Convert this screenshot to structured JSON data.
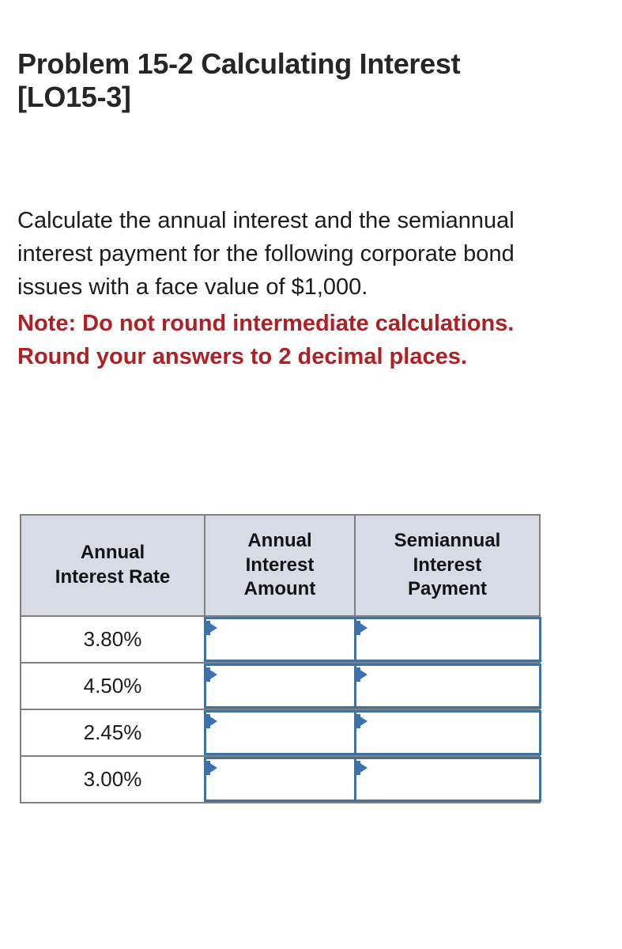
{
  "problem": {
    "title": "Problem 15-2 Calculating Interest [LO15-3]",
    "prompt": "Calculate the annual interest and the semiannual interest payment for the following corporate bond issues with a face value of $1,000.",
    "note": "Note: Do not round intermediate calculations. Round your answers to 2 decimal places."
  },
  "colors": {
    "header_bg": "#d6dbe6",
    "grid_border": "#808080",
    "input_border": "#41719c",
    "flag_blue": "#3a72b3",
    "note_red": "#b01f24",
    "text": "#1c1c1c"
  },
  "table": {
    "headers": [
      {
        "lines": [
          "Annual",
          "Interest Rate"
        ]
      },
      {
        "lines": [
          "Annual",
          "Interest",
          "Amount"
        ]
      },
      {
        "lines": [
          "Semiannual",
          "Interest",
          "Payment"
        ]
      }
    ],
    "rows": [
      {
        "rate": "3.80%",
        "annual_interest_amount": "",
        "semiannual_interest_payment": "",
        "placeholder": ""
      },
      {
        "rate": "4.50%",
        "annual_interest_amount": "",
        "semiannual_interest_payment": "",
        "placeholder": ""
      },
      {
        "rate": "2.45%",
        "annual_interest_amount": "",
        "semiannual_interest_payment": "",
        "placeholder": ""
      },
      {
        "rate": "3.00%",
        "annual_interest_amount": "",
        "semiannual_interest_payment": "",
        "placeholder": ""
      }
    ]
  }
}
